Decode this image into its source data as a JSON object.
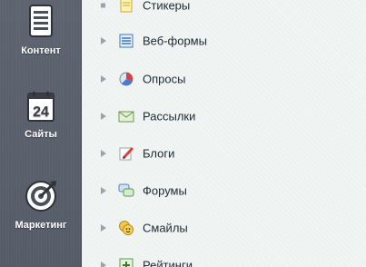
{
  "sidebar": {
    "items": [
      {
        "label": "Контент",
        "icon": "document-icon"
      },
      {
        "label": "Сайты",
        "icon": "calendar-24-icon",
        "icon_text": "24"
      },
      {
        "label": "Маркетинг",
        "icon": "target-icon"
      }
    ]
  },
  "menu": {
    "items": [
      {
        "label": "Стикеры",
        "icon": "sticker-icon",
        "marker": "dot"
      },
      {
        "label": "Веб-формы",
        "icon": "web-form-icon",
        "marker": "arrow"
      },
      {
        "label": "Опросы",
        "icon": "poll-pie-icon",
        "marker": "arrow"
      },
      {
        "label": "Рассылки",
        "icon": "mail-icon",
        "marker": "arrow"
      },
      {
        "label": "Блоги",
        "icon": "blog-pencil-icon",
        "marker": "arrow"
      },
      {
        "label": "Форумы",
        "icon": "forum-bubbles-icon",
        "marker": "arrow"
      },
      {
        "label": "Смайлы",
        "icon": "smiley-icon",
        "marker": "arrow"
      },
      {
        "label": "Рейтинги",
        "icon": "rating-plus-icon",
        "marker": "arrow"
      }
    ]
  },
  "colors": {
    "sidebar_bg": "#5a616c",
    "panel_bg": "#eef2f1",
    "text": "#1f2a30",
    "arrow": "#9aa3a7"
  }
}
